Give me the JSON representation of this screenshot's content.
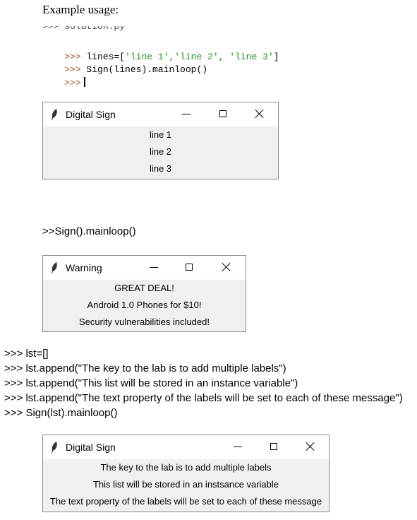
{
  "heading": "Example usage:",
  "code": {
    "line0": ">>> solution.py",
    "line1_prompt": ">>>",
    "line1_code": " lines=[",
    "line1_strings": "'line 1','line 2', 'line 3'",
    "line1_end": "]",
    "line2_prompt": ">>>",
    "line2_code": " Sign(lines).mainloop()",
    "line3_prompt": ">>>"
  },
  "window1": {
    "title": "Digital Sign",
    "labels": [
      "line 1",
      "line 2",
      "line 3"
    ]
  },
  "call2": ">>Sign().mainloop()",
  "window2": {
    "title": "Warning",
    "labels": [
      "GREAT DEAL!",
      "Android 1.0 Phones for $10!",
      "Security vulnerabilities included!"
    ]
  },
  "session3": [
    ">>> lst=[]",
    ">>> lst.append(\"The key to the lab is to add multiple labels\")",
    ">>> lst.append(\"This list will be stored in an instance variable\")",
    ">>> lst.append(\"The text property of the labels will be set to each of these message\")",
    ">>> Sign(lst).mainloop()"
  ],
  "window3": {
    "title": "Digital Sign",
    "labels": [
      "The key to the lab is to add multiple labels",
      "This list will be stored in an instsance variable",
      "The text property of the labels will be set to each of these message"
    ]
  },
  "icons": [
    "feather-icon",
    "minimize-icon",
    "maximize-icon",
    "close-icon"
  ]
}
